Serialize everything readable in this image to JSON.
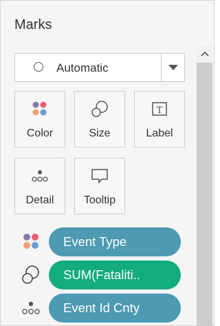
{
  "marks": {
    "title": "Marks",
    "mark_type": {
      "selected": "Automatic",
      "icon": "circle-icon"
    },
    "cards": [
      {
        "label": "Color",
        "icon": "color-icon"
      },
      {
        "label": "Size",
        "icon": "size-icon"
      },
      {
        "label": "Label",
        "icon": "label-icon"
      },
      {
        "label": "Detail",
        "icon": "detail-icon"
      },
      {
        "label": "Tooltip",
        "icon": "tooltip-icon"
      }
    ],
    "fields": [
      {
        "role_icon": "color-icon",
        "name": "Event Type",
        "color": "#4d9ab2"
      },
      {
        "role_icon": "size-icon",
        "name": "SUM(Fataliti..",
        "color": "#12ac7e"
      },
      {
        "role_icon": "detail-icon",
        "name": "Event Id Cnty",
        "color": "#4d9ab2"
      }
    ]
  },
  "colors": {
    "panel_bg": "#f5f5f5",
    "dimension_pill": "#4d9ab2",
    "measure_pill": "#12ac7e"
  }
}
